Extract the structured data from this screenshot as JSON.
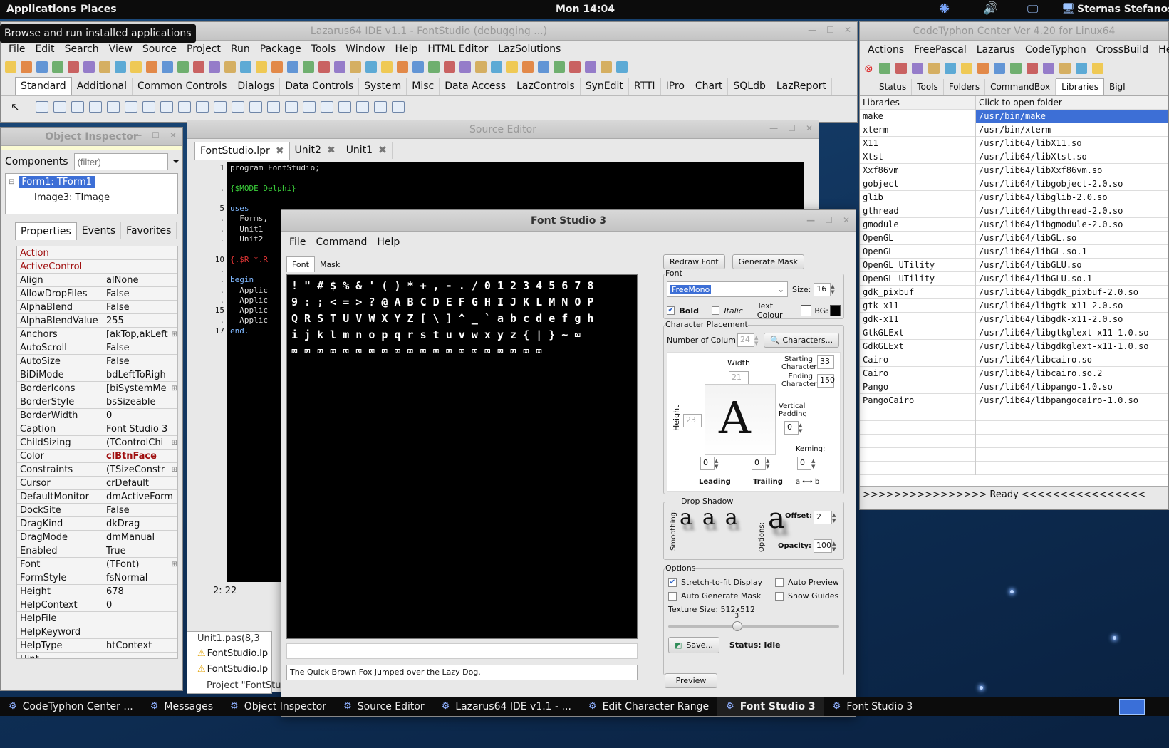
{
  "topbar": {
    "applications": "Applications",
    "places": "Places",
    "clock": "Mon 14:04",
    "user": "Sternas Stefanos"
  },
  "tooltip": "Browse and run installed applications",
  "lazarus": {
    "title": "Lazarus64 IDE v1.1 - FontStudio (debugging ...)",
    "menu": [
      "File",
      "Edit",
      "Search",
      "View",
      "Source",
      "Project",
      "Run",
      "Package",
      "Tools",
      "Window",
      "Help",
      "HTML Editor",
      "LazSolutions"
    ],
    "palette_tabs": [
      "Standard",
      "Additional",
      "Common Controls",
      "Dialogs",
      "Data Controls",
      "System",
      "Misc",
      "Data Access",
      "LazControls",
      "SynEdit",
      "RTTI",
      "IPro",
      "Chart",
      "SQLdb",
      "LazReport"
    ]
  },
  "inspector": {
    "title": "Object Inspector",
    "components_label": "Components",
    "filter_placeholder": "(filter)",
    "tree": [
      "Form1: TForm1",
      "Image3: TImage"
    ],
    "tabs": [
      "Properties",
      "Events",
      "Favorites"
    ],
    "props": [
      {
        "k": "Action",
        "v": "",
        "red": true
      },
      {
        "k": "ActiveControl",
        "v": "",
        "red": true
      },
      {
        "k": "Align",
        "v": "alNone"
      },
      {
        "k": "AllowDropFiles",
        "v": "False"
      },
      {
        "k": "AlphaBlend",
        "v": "False"
      },
      {
        "k": "AlphaBlendValue",
        "v": "255"
      },
      {
        "k": "Anchors",
        "v": "[akTop,akLeft",
        "plus": true
      },
      {
        "k": "AutoScroll",
        "v": "False"
      },
      {
        "k": "AutoSize",
        "v": "False"
      },
      {
        "k": "BiDiMode",
        "v": "bdLeftToRigh"
      },
      {
        "k": "BorderIcons",
        "v": "[biSystemMe",
        "plus": true
      },
      {
        "k": "BorderStyle",
        "v": "bsSizeable"
      },
      {
        "k": "BorderWidth",
        "v": "0"
      },
      {
        "k": "Caption",
        "v": "Font Studio 3"
      },
      {
        "k": "ChildSizing",
        "v": "(TControlChi",
        "plus": true
      },
      {
        "k": "Color",
        "v": "clBtnFace",
        "color": true
      },
      {
        "k": "Constraints",
        "v": "(TSizeConstr",
        "plus": true
      },
      {
        "k": "Cursor",
        "v": "crDefault"
      },
      {
        "k": "DefaultMonitor",
        "v": "dmActiveForm"
      },
      {
        "k": "DockSite",
        "v": "False"
      },
      {
        "k": "DragKind",
        "v": "dkDrag"
      },
      {
        "k": "DragMode",
        "v": "dmManual"
      },
      {
        "k": "Enabled",
        "v": "True"
      },
      {
        "k": "Font",
        "v": "(TFont)",
        "plus": true
      },
      {
        "k": "FormStyle",
        "v": "fsNormal"
      },
      {
        "k": "Height",
        "v": "678"
      },
      {
        "k": "HelpContext",
        "v": "0"
      },
      {
        "k": "HelpFile",
        "v": ""
      },
      {
        "k": "HelpKeyword",
        "v": ""
      },
      {
        "k": "HelpType",
        "v": "htContext"
      },
      {
        "k": "Hint",
        "v": ""
      }
    ]
  },
  "source": {
    "title": "Source Editor",
    "tabs": [
      "FontStudio.lpr",
      "Unit2",
      "Unit1"
    ],
    "lines": [
      {
        "n": "1",
        "t": "program FontStudio;",
        "c": "#ddd",
        "kw": "program"
      },
      {
        "n": "",
        "t": "",
        "c": "#ddd"
      },
      {
        "n": ".",
        "t": "{$MODE Delphi}",
        "c": "#3bd13b"
      },
      {
        "n": "",
        "t": "",
        "c": "#ddd"
      },
      {
        "n": "5",
        "t": "uses",
        "c": "#7fb8ff"
      },
      {
        "n": ".",
        "t": "  Forms,",
        "c": "#ddd"
      },
      {
        "n": ".",
        "t": "  Unit1",
        "c": "#ddd"
      },
      {
        "n": ".",
        "t": "  Unit2",
        "c": "#ddd"
      },
      {
        "n": "",
        "t": "",
        "c": "#ddd"
      },
      {
        "n": "10",
        "t": "{.$R *.R",
        "c": "#e03535"
      },
      {
        "n": ".",
        "t": "",
        "c": "#ddd"
      },
      {
        "n": ".",
        "t": "begin",
        "c": "#7fb8ff"
      },
      {
        "n": ".",
        "t": "  Applic",
        "c": "#ddd"
      },
      {
        "n": ".",
        "t": "  Applic",
        "c": "#ddd"
      },
      {
        "n": "15",
        "t": "  Applic",
        "c": "#ddd"
      },
      {
        "n": ".",
        "t": "  Applic",
        "c": "#ddd"
      },
      {
        "n": "17",
        "t": "end.",
        "c": "#7fb8ff"
      }
    ],
    "status": "2:  22",
    "messages": [
      "Unit1.pas(8,3",
      "FontStudio.lp",
      "FontStudio.lp",
      "Project \"FontStudio\" successfully built"
    ]
  },
  "fontstudio": {
    "title": "Font Studio 3",
    "menu": [
      "File",
      "Command",
      "Help"
    ],
    "tabs": [
      "Font",
      "Mask"
    ],
    "glyph_rows": [
      "! \" # $ % & ' ( ) * + , - . / 0 1 2 3 4 5 6 7 8",
      "9 : ; < = > ? @ A B C D E F G H I J K L M N O P",
      "Q R S T U V W X Y Z [ \\ ] ^ _ ` a b c d e f g h",
      "i j k l m n o p q r s t u v w x y z { | } ~ ⌧",
      "⌧ ⌧ ⌧ ⌧ ⌧ ⌧ ⌧ ⌧ ⌧ ⌧ ⌧ ⌧ ⌧ ⌧ ⌧ ⌧ ⌧ ⌧ ⌧ ⌧"
    ],
    "preview_text": "The Quick Brown Fox jumped over the Lazy Dog.",
    "redraw": "Redraw Font",
    "generate": "Generate Mask",
    "font_group": "Font",
    "font_name": "FreeMono",
    "size_label": "Size:",
    "size": "16",
    "bold": "Bold",
    "italic": "Italic",
    "text_colour": "Text Colour",
    "bg": "BG:",
    "char_group": "Character Placement",
    "num_cols_label": "Number of Colum",
    "num_cols": "24",
    "characters": "Characters...",
    "width_label": "Width",
    "width": "21",
    "height_label": "Height",
    "height": "23",
    "start_char": "Starting Character",
    "start": "33",
    "end_char": "Ending Character",
    "end": "150",
    "vpad": "Vertical Padding",
    "vpad_v": "0",
    "kerning": "Kerning:",
    "leading": "Leading",
    "leading_v": "0",
    "trailing": "Trailing",
    "trailing_v": "0",
    "kern_v": "0",
    "kern_ab": "a ⟷ b",
    "sample_glyph": "A",
    "shadow_group": "Drop Shadow",
    "smoothing": "Smoothing:",
    "options_lbl": "Options:",
    "offset": "Offset:",
    "offset_v": "2",
    "opacity": "Opacity:",
    "opacity_v": "100",
    "shadow_glyph": "a",
    "options_group": "Options",
    "stretch": "Stretch-to-fit Display",
    "auto_preview": "Auto Preview",
    "auto_mask": "Auto Generate Mask",
    "guides": "Show Guides",
    "texture": "Texture Size: 512x512",
    "slider_val": "3",
    "slider_frac": 0.4,
    "save": "Save...",
    "status": "Status: Idle",
    "preview_btn": "Preview"
  },
  "codetyphon": {
    "title": "CodeTyphon Center Ver 4.20 for Linux64",
    "menu": [
      "Actions",
      "FreePascal",
      "Lazarus",
      "CodeTyphon",
      "CrossBuild",
      "Help"
    ],
    "tabs": [
      "Status",
      "Tools",
      "Folders",
      "CommandBox",
      "Libraries",
      "BigI"
    ],
    "col1": "Libraries",
    "col2": "Click to open folder",
    "libs": [
      [
        "make",
        "/usr/bin/make"
      ],
      [
        "xterm",
        "/usr/bin/xterm"
      ],
      [
        "X11",
        "/usr/lib64/libX11.so"
      ],
      [
        "Xtst",
        "/usr/lib64/libXtst.so"
      ],
      [
        "Xxf86vm",
        "/usr/lib64/libXxf86vm.so"
      ],
      [
        "gobject",
        "/usr/lib64/libgobject-2.0.so"
      ],
      [
        "glib",
        "/usr/lib64/libglib-2.0.so"
      ],
      [
        "gthread",
        "/usr/lib64/libgthread-2.0.so"
      ],
      [
        "gmodule",
        "/usr/lib64/libgmodule-2.0.so"
      ],
      [
        "OpenGL",
        "/usr/lib64/libGL.so"
      ],
      [
        "OpenGL",
        "/usr/lib64/libGL.so.1"
      ],
      [
        "OpenGL UTility",
        "/usr/lib64/libGLU.so"
      ],
      [
        "OpenGL UTility",
        "/usr/lib64/libGLU.so.1"
      ],
      [
        "gdk_pixbuf",
        "/usr/lib64/libgdk_pixbuf-2.0.so"
      ],
      [
        "gtk-x11",
        "/usr/lib64/libgtk-x11-2.0.so"
      ],
      [
        "gdk-x11",
        "/usr/lib64/libgdk-x11-2.0.so"
      ],
      [
        "GtkGLExt",
        "/usr/lib64/libgtkglext-x11-1.0.so"
      ],
      [
        "GdkGLExt",
        "/usr/lib64/libgdkglext-x11-1.0.so"
      ],
      [
        "Cairo",
        "/usr/lib64/libcairo.so"
      ],
      [
        "Cairo",
        "/usr/lib64/libcairo.so.2"
      ],
      [
        "Pango",
        "/usr/lib64/libpango-1.0.so"
      ],
      [
        "PangoCairo",
        "/usr/lib64/libpangocairo-1.0.so"
      ]
    ],
    "status": ">>>>>>>>>>>>>>>> Ready <<<<<<<<<<<<<<<<"
  },
  "taskbar": [
    {
      "label": "CodeTyphon Center ...",
      "sel": false
    },
    {
      "label": "Messages",
      "sel": false
    },
    {
      "label": "Object Inspector",
      "sel": false
    },
    {
      "label": "Source Editor",
      "sel": false
    },
    {
      "label": "Lazarus64 IDE v1.1 - ...",
      "sel": false
    },
    {
      "label": "Edit Character Range",
      "sel": false
    },
    {
      "label": "Font Studio 3",
      "sel": true
    },
    {
      "label": "Font Studio 3",
      "sel": false
    }
  ],
  "colors": {
    "accent": "#3a6fd8",
    "selection": "#3d6fd6",
    "props_red": "#a01010"
  }
}
